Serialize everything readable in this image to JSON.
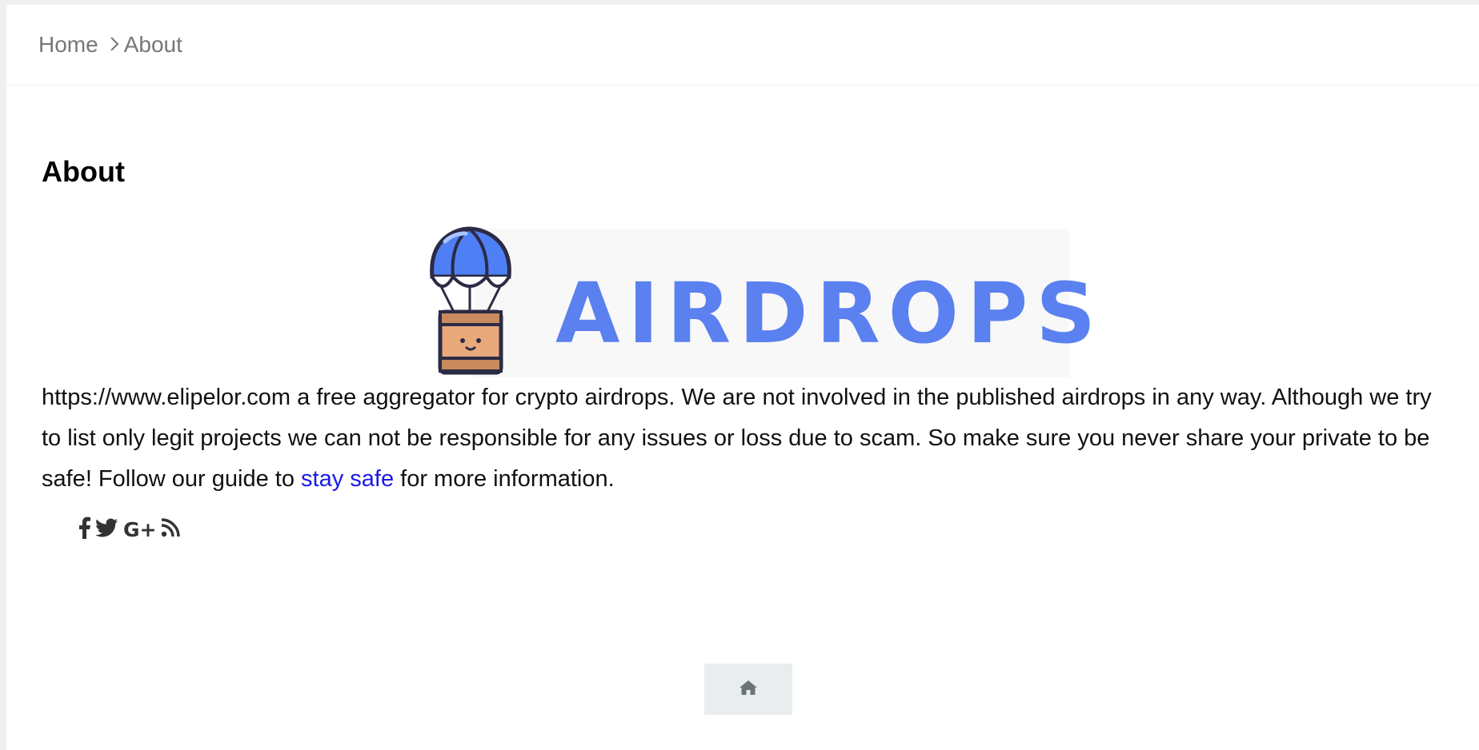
{
  "breadcrumb": {
    "home": "Home",
    "current": "About"
  },
  "page": {
    "title": "About"
  },
  "banner": {
    "logo_text": "AIRDROPS",
    "icon": "parachute-box-icon",
    "color": "#5b80f0"
  },
  "content": {
    "text_before": "https://www.elipelor.com a free aggregator for crypto airdrops. We are not involved in the published airdrops in any way. Although we try to list only legit projects we can not be responsible for any issues or loss due to scam. So make sure you never share your private to be safe! Follow our guide to ",
    "link_text": "stay safe",
    "text_after": " for more information."
  },
  "social": {
    "icons": [
      "facebook-icon",
      "twitter-icon",
      "google-plus-icon",
      "rss-icon"
    ],
    "gplus_label": "G+"
  },
  "footer": {
    "home_icon": "home-icon"
  }
}
